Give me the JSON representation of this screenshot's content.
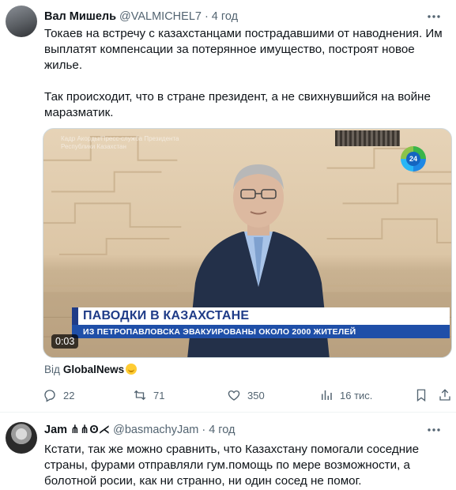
{
  "tweet1": {
    "author_name": "Вал Мишель",
    "author_handle": "@VALMICHEL7",
    "separator": "·",
    "time": "4 год",
    "paragraph1": "Токаев на встречу с казахстанцами пострадавшими от наводнения.  Им выплатят компенсации за потерянное имущество, построят новое жилье.",
    "paragraph2": "Так происходит, что в стране президент, а не свихнувшийся на войне маразматик.",
    "video": {
      "watermark": "Кадр Акорды/Пресс-служба Президента Республики Казахстан",
      "channel_logo": "24",
      "banner_title": "ПАВОДКИ В КАЗАХСТАНЕ",
      "banner_subtitle": "ИЗ ПЕТРОПАВЛОВСКА ЭВАКУИРОВАНЫ ОКОЛО 2000 ЖИТЕЛЕЙ",
      "duration": "0:03"
    },
    "source_prefix": "Від",
    "source_name": "GlobalNews",
    "actions": {
      "replies": "22",
      "retweets": "71",
      "likes": "350",
      "views": "16 тис."
    }
  },
  "tweet2": {
    "author_name": "Jam ⋔⋔ʘ⋌",
    "author_handle": "@basmachyJam",
    "separator": "·",
    "time": "4 год",
    "text": "Кстати, так же можно сравнить, что Казахстану помогали соседние страны, фурами отправляли гум.помощь по мере возможности, а болотной росии, как ни странно, ни один сосед не помог."
  },
  "icons": [
    "more-icon",
    "reply-icon",
    "retweet-icon",
    "like-icon",
    "views-icon",
    "bookmark-icon",
    "share-icon"
  ],
  "colors": {
    "text": "#0f1419",
    "secondary": "#536471",
    "banner_blue": "#1f4fa8"
  }
}
